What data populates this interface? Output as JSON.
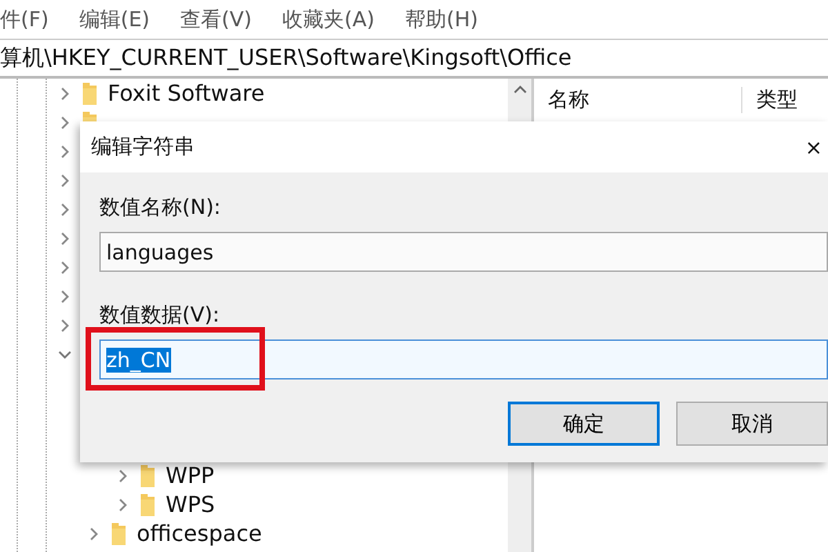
{
  "menu": [
    "件(F)",
    "编辑(E)",
    "查看(V)",
    "收藏夹(A)",
    "帮助(H)"
  ],
  "address": "算机\\HKEY_CURRENT_USER\\Software\\Kingsoft\\Office",
  "tree": [
    {
      "label": "Foxit Software",
      "expanded": false
    },
    {
      "expanded": false
    },
    {
      "expanded": false
    },
    {
      "expanded": false
    },
    {
      "expanded": false
    },
    {
      "expanded": false
    },
    {
      "expanded": false
    },
    {
      "expanded": false
    },
    {
      "expanded": false
    },
    {
      "expanded": true,
      "children": [
        {
          "children": [
            {
              "label": "WPP",
              "expanded": false
            },
            {
              "label": "WPS",
              "expanded": false
            }
          ]
        },
        {
          "label": "officespace",
          "expanded": false
        }
      ]
    }
  ],
  "list": {
    "columns": [
      "名称",
      "类型"
    ]
  },
  "dialog": {
    "title": "编辑字符串",
    "close": "×",
    "fields": [
      {
        "label": "数值名称(N):",
        "value": "languages",
        "selected": false,
        "focused": false
      },
      {
        "label": "数值数据(V):",
        "value": "zh_CN",
        "selected": true,
        "focused": true,
        "highlighted": true
      }
    ],
    "buttons": [
      {
        "label": "确定",
        "default": true
      },
      {
        "label": "取消",
        "default": false
      }
    ]
  }
}
